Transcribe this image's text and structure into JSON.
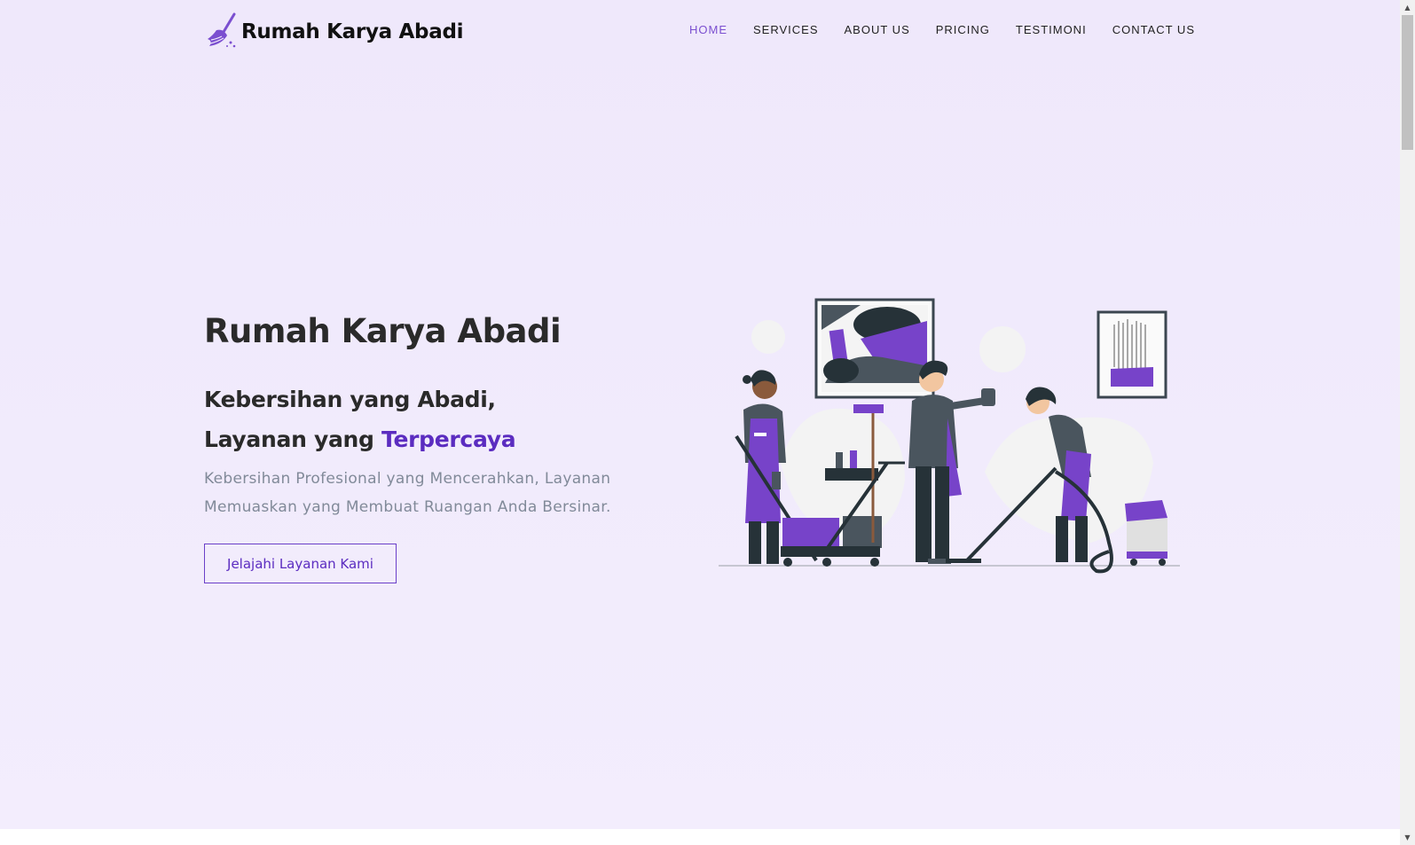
{
  "brand": {
    "name": "Rumah Karya Abadi",
    "logo_icon": "broom-icon"
  },
  "nav": {
    "items": [
      {
        "label": "HOME",
        "active": true
      },
      {
        "label": "SERVICES",
        "active": false
      },
      {
        "label": "ABOUT US",
        "active": false
      },
      {
        "label": "PRICING",
        "active": false
      },
      {
        "label": "TESTIMONI",
        "active": false
      },
      {
        "label": "CONTACT US",
        "active": false
      }
    ]
  },
  "hero": {
    "title": "Rumah Karya Abadi",
    "subtitle_line1": "Kebersihan yang Abadi,",
    "subtitle_line2_prefix": "Layanan yang ",
    "subtitle_line2_accent": "Terpercaya",
    "description": "Kebersihan Profesional yang Mencerahkan, Layanan Memuaskan yang Membuat Ruangan Anda Bersinar.",
    "cta_label": "Jelajahi Layanan Kami"
  },
  "colors": {
    "accent": "#5b2cc0",
    "accent_light": "#7b4fd0",
    "background": "#f1ecfb",
    "text_dark": "#2a2a2a",
    "text_muted": "#818a99"
  }
}
